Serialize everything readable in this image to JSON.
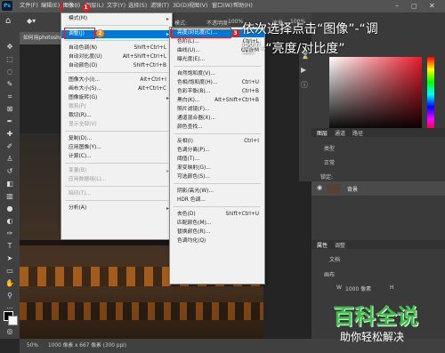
{
  "menubar": {
    "logo": "Ps",
    "items": [
      "文件(F)",
      "编辑(E)",
      "图像(I)",
      "图层(L)",
      "文字(Y)",
      "选择(S)",
      "滤镜(T)",
      "3D(D)",
      "视图(V)",
      "窗口(W)",
      "帮助(H)"
    ]
  },
  "optbar": {
    "mode_label": "模式:",
    "opacity_label": "不透明度:",
    "opacity_value": "100%",
    "flow_label": "流量:",
    "flow_value": "100%"
  },
  "document": {
    "tab_title": "如何用photoshop...",
    "status_zoom": "50%",
    "status_info": "1000 像素 x 667 像素 (300 ppi)"
  },
  "image_menu": {
    "items": [
      {
        "label": "模式(M)",
        "shortcut": ""
      },
      {
        "label": "调整(J)",
        "shortcut": ""
      },
      {
        "label": "自动色调(N)",
        "shortcut": "Shift+Ctrl+L"
      },
      {
        "label": "自动对比度(U)",
        "shortcut": "Alt+Shift+Ctrl+L"
      },
      {
        "label": "自动颜色(O)",
        "shortcut": "Shift+Ctrl+B"
      },
      {
        "label": "图像大小(I)...",
        "shortcut": "Alt+Ctrl+I"
      },
      {
        "label": "画布大小(S)...",
        "shortcut": "Alt+Ctrl+C"
      },
      {
        "label": "图像旋转(G)",
        "shortcut": ""
      },
      {
        "label": "裁剪(P)",
        "shortcut": ""
      },
      {
        "label": "裁切(R)...",
        "shortcut": ""
      },
      {
        "label": "显示全部(V)",
        "shortcut": ""
      },
      {
        "label": "复制(D)...",
        "shortcut": ""
      },
      {
        "label": "应用图像(Y)...",
        "shortcut": ""
      },
      {
        "label": "计算(C)...",
        "shortcut": ""
      },
      {
        "label": "变量(B)",
        "shortcut": ""
      },
      {
        "label": "应用数据组(L)...",
        "shortcut": ""
      },
      {
        "label": "陷印(T)...",
        "shortcut": ""
      },
      {
        "label": "分析(A)",
        "shortcut": ""
      }
    ]
  },
  "adjust_menu": {
    "items": [
      {
        "label": "亮度/对比度(C)...",
        "shortcut": ""
      },
      {
        "label": "色阶(L)...",
        "shortcut": "Ctrl+L"
      },
      {
        "label": "曲线(U)...",
        "shortcut": "Ctrl+M"
      },
      {
        "label": "曝光度(E)...",
        "shortcut": ""
      },
      {
        "label": "自然饱和度(V)...",
        "shortcut": ""
      },
      {
        "label": "色相/饱和度(H)...",
        "shortcut": "Ctrl+U"
      },
      {
        "label": "色彩平衡(B)...",
        "shortcut": "Ctrl+B"
      },
      {
        "label": "黑白(K)...",
        "shortcut": "Alt+Shift+Ctrl+B"
      },
      {
        "label": "照片滤镜(F)...",
        "shortcut": ""
      },
      {
        "label": "通道混合器(X)...",
        "shortcut": ""
      },
      {
        "label": "颜色查找...",
        "shortcut": ""
      },
      {
        "label": "反相(I)",
        "shortcut": "Ctrl+I"
      },
      {
        "label": "色调分离(P)...",
        "shortcut": ""
      },
      {
        "label": "阈值(T)...",
        "shortcut": ""
      },
      {
        "label": "渐变映射(G)...",
        "shortcut": ""
      },
      {
        "label": "可选颜色(S)...",
        "shortcut": ""
      },
      {
        "label": "阴影/高光(W)...",
        "shortcut": ""
      },
      {
        "label": "HDR 色调...",
        "shortcut": ""
      },
      {
        "label": "去色(D)",
        "shortcut": "Shift+Ctrl+U"
      },
      {
        "label": "匹配颜色(M)...",
        "shortcut": ""
      },
      {
        "label": "替换颜色(R)...",
        "shortcut": ""
      },
      {
        "label": "色调均化(Q)",
        "shortcut": ""
      }
    ]
  },
  "badges": {
    "b1": "1",
    "b2": "2",
    "b3": "3"
  },
  "annotation": {
    "line1": "依次选择点击“图像”-“调",
    "line2": "整”-“亮度/对比度”"
  },
  "layers": {
    "tabs": [
      "图层",
      "通道",
      "路径"
    ],
    "kind_label": "类型",
    "blend_mode": "正常",
    "lock_label": "锁定:",
    "layer_name": "背景"
  },
  "properties": {
    "tabs": [
      "属性",
      "调整"
    ],
    "doc_label": "文档",
    "canvas_label": "画布",
    "w_label": "W",
    "w_value": "1000 像素",
    "h_label": "H"
  },
  "watermark": {
    "title": "百科全说",
    "subtitle": "助你轻松解决"
  },
  "colors": {
    "menu_bg": "#f1f1f1",
    "highlight": "#0078d7",
    "accent_red": "#e02020",
    "ps_blue": "#31a8ff"
  }
}
